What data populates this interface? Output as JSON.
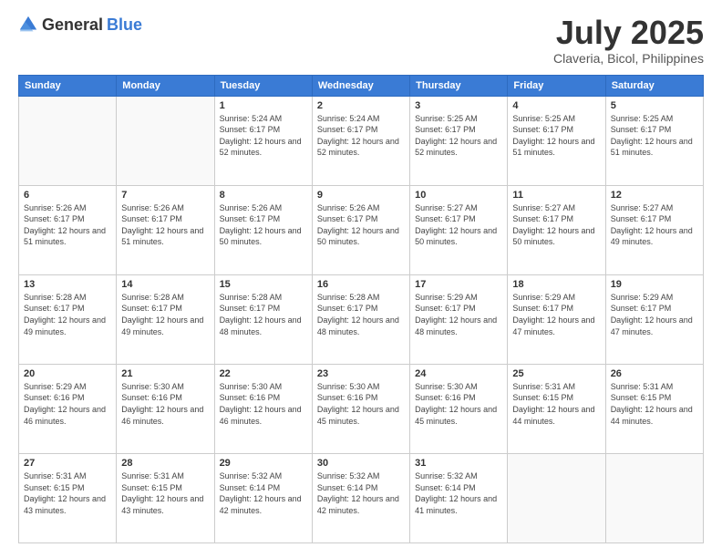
{
  "header": {
    "logo": {
      "general": "General",
      "blue": "Blue"
    },
    "month": "July 2025",
    "location": "Claveria, Bicol, Philippines"
  },
  "weekdays": [
    "Sunday",
    "Monday",
    "Tuesday",
    "Wednesday",
    "Thursday",
    "Friday",
    "Saturday"
  ],
  "weeks": [
    [
      {
        "day": "",
        "sunrise": "",
        "sunset": "",
        "daylight": ""
      },
      {
        "day": "",
        "sunrise": "",
        "sunset": "",
        "daylight": ""
      },
      {
        "day": "1",
        "sunrise": "Sunrise: 5:24 AM",
        "sunset": "Sunset: 6:17 PM",
        "daylight": "Daylight: 12 hours and 52 minutes."
      },
      {
        "day": "2",
        "sunrise": "Sunrise: 5:24 AM",
        "sunset": "Sunset: 6:17 PM",
        "daylight": "Daylight: 12 hours and 52 minutes."
      },
      {
        "day": "3",
        "sunrise": "Sunrise: 5:25 AM",
        "sunset": "Sunset: 6:17 PM",
        "daylight": "Daylight: 12 hours and 52 minutes."
      },
      {
        "day": "4",
        "sunrise": "Sunrise: 5:25 AM",
        "sunset": "Sunset: 6:17 PM",
        "daylight": "Daylight: 12 hours and 51 minutes."
      },
      {
        "day": "5",
        "sunrise": "Sunrise: 5:25 AM",
        "sunset": "Sunset: 6:17 PM",
        "daylight": "Daylight: 12 hours and 51 minutes."
      }
    ],
    [
      {
        "day": "6",
        "sunrise": "Sunrise: 5:26 AM",
        "sunset": "Sunset: 6:17 PM",
        "daylight": "Daylight: 12 hours and 51 minutes."
      },
      {
        "day": "7",
        "sunrise": "Sunrise: 5:26 AM",
        "sunset": "Sunset: 6:17 PM",
        "daylight": "Daylight: 12 hours and 51 minutes."
      },
      {
        "day": "8",
        "sunrise": "Sunrise: 5:26 AM",
        "sunset": "Sunset: 6:17 PM",
        "daylight": "Daylight: 12 hours and 50 minutes."
      },
      {
        "day": "9",
        "sunrise": "Sunrise: 5:26 AM",
        "sunset": "Sunset: 6:17 PM",
        "daylight": "Daylight: 12 hours and 50 minutes."
      },
      {
        "day": "10",
        "sunrise": "Sunrise: 5:27 AM",
        "sunset": "Sunset: 6:17 PM",
        "daylight": "Daylight: 12 hours and 50 minutes."
      },
      {
        "day": "11",
        "sunrise": "Sunrise: 5:27 AM",
        "sunset": "Sunset: 6:17 PM",
        "daylight": "Daylight: 12 hours and 50 minutes."
      },
      {
        "day": "12",
        "sunrise": "Sunrise: 5:27 AM",
        "sunset": "Sunset: 6:17 PM",
        "daylight": "Daylight: 12 hours and 49 minutes."
      }
    ],
    [
      {
        "day": "13",
        "sunrise": "Sunrise: 5:28 AM",
        "sunset": "Sunset: 6:17 PM",
        "daylight": "Daylight: 12 hours and 49 minutes."
      },
      {
        "day": "14",
        "sunrise": "Sunrise: 5:28 AM",
        "sunset": "Sunset: 6:17 PM",
        "daylight": "Daylight: 12 hours and 49 minutes."
      },
      {
        "day": "15",
        "sunrise": "Sunrise: 5:28 AM",
        "sunset": "Sunset: 6:17 PM",
        "daylight": "Daylight: 12 hours and 48 minutes."
      },
      {
        "day": "16",
        "sunrise": "Sunrise: 5:28 AM",
        "sunset": "Sunset: 6:17 PM",
        "daylight": "Daylight: 12 hours and 48 minutes."
      },
      {
        "day": "17",
        "sunrise": "Sunrise: 5:29 AM",
        "sunset": "Sunset: 6:17 PM",
        "daylight": "Daylight: 12 hours and 48 minutes."
      },
      {
        "day": "18",
        "sunrise": "Sunrise: 5:29 AM",
        "sunset": "Sunset: 6:17 PM",
        "daylight": "Daylight: 12 hours and 47 minutes."
      },
      {
        "day": "19",
        "sunrise": "Sunrise: 5:29 AM",
        "sunset": "Sunset: 6:17 PM",
        "daylight": "Daylight: 12 hours and 47 minutes."
      }
    ],
    [
      {
        "day": "20",
        "sunrise": "Sunrise: 5:29 AM",
        "sunset": "Sunset: 6:16 PM",
        "daylight": "Daylight: 12 hours and 46 minutes."
      },
      {
        "day": "21",
        "sunrise": "Sunrise: 5:30 AM",
        "sunset": "Sunset: 6:16 PM",
        "daylight": "Daylight: 12 hours and 46 minutes."
      },
      {
        "day": "22",
        "sunrise": "Sunrise: 5:30 AM",
        "sunset": "Sunset: 6:16 PM",
        "daylight": "Daylight: 12 hours and 46 minutes."
      },
      {
        "day": "23",
        "sunrise": "Sunrise: 5:30 AM",
        "sunset": "Sunset: 6:16 PM",
        "daylight": "Daylight: 12 hours and 45 minutes."
      },
      {
        "day": "24",
        "sunrise": "Sunrise: 5:30 AM",
        "sunset": "Sunset: 6:16 PM",
        "daylight": "Daylight: 12 hours and 45 minutes."
      },
      {
        "day": "25",
        "sunrise": "Sunrise: 5:31 AM",
        "sunset": "Sunset: 6:15 PM",
        "daylight": "Daylight: 12 hours and 44 minutes."
      },
      {
        "day": "26",
        "sunrise": "Sunrise: 5:31 AM",
        "sunset": "Sunset: 6:15 PM",
        "daylight": "Daylight: 12 hours and 44 minutes."
      }
    ],
    [
      {
        "day": "27",
        "sunrise": "Sunrise: 5:31 AM",
        "sunset": "Sunset: 6:15 PM",
        "daylight": "Daylight: 12 hours and 43 minutes."
      },
      {
        "day": "28",
        "sunrise": "Sunrise: 5:31 AM",
        "sunset": "Sunset: 6:15 PM",
        "daylight": "Daylight: 12 hours and 43 minutes."
      },
      {
        "day": "29",
        "sunrise": "Sunrise: 5:32 AM",
        "sunset": "Sunset: 6:14 PM",
        "daylight": "Daylight: 12 hours and 42 minutes."
      },
      {
        "day": "30",
        "sunrise": "Sunrise: 5:32 AM",
        "sunset": "Sunset: 6:14 PM",
        "daylight": "Daylight: 12 hours and 42 minutes."
      },
      {
        "day": "31",
        "sunrise": "Sunrise: 5:32 AM",
        "sunset": "Sunset: 6:14 PM",
        "daylight": "Daylight: 12 hours and 41 minutes."
      },
      {
        "day": "",
        "sunrise": "",
        "sunset": "",
        "daylight": ""
      },
      {
        "day": "",
        "sunrise": "",
        "sunset": "",
        "daylight": ""
      }
    ]
  ]
}
